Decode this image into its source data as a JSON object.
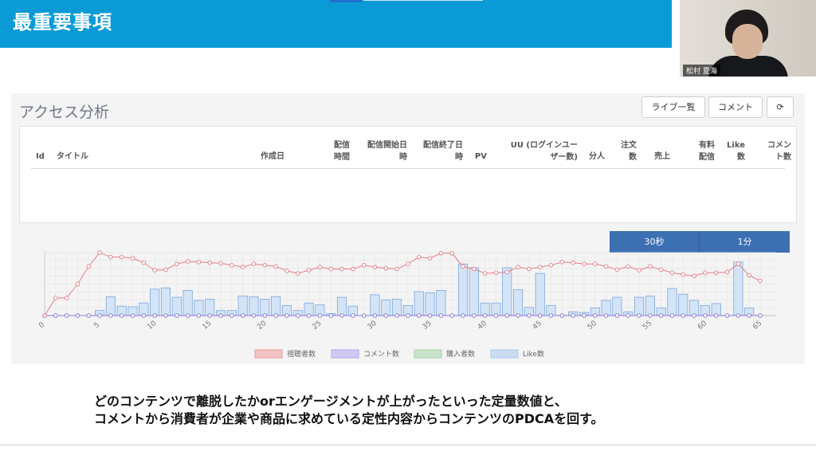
{
  "banner": {
    "title": "最重要事項"
  },
  "video": {
    "name": "松村 夏海"
  },
  "panel": {
    "title": "アクセス分析"
  },
  "toolbar": {
    "live_label": "ライブ一覧",
    "comment_label": "コメント",
    "refresh_glyph": "⟳"
  },
  "table": {
    "headers": [
      "Id",
      "タイトル",
      "作成日",
      "配信\n時間",
      "配信開始日\n時",
      "配信終了日\n時",
      "PV",
      "UU (ログインユー\nザー数)",
      "分人",
      "注文\n数",
      "売上",
      "有料\n配信",
      "Like\n数",
      "コメン\nト数"
    ]
  },
  "range_buttons": {
    "thirty_sec": "30秒",
    "one_min": "1分"
  },
  "chart_data": {
    "type": "line",
    "x_ticks": [
      "0",
      "5",
      "10",
      "15",
      "20",
      "25",
      "30",
      "35",
      "40",
      "45",
      "50",
      "55",
      "60",
      "65"
    ],
    "xlim": [
      0,
      65
    ],
    "legend": [
      "視聴者数",
      "コメント数",
      "購入者数",
      "Like数"
    ],
    "legend_colors": [
      "#ef9a9a",
      "#b3a6f2",
      "#a5d6a7",
      "#a9c8ef"
    ],
    "series": [
      {
        "name": "視聴者数",
        "kind": "line",
        "values": [
          0,
          28,
          28,
          50,
          78,
          100,
          93,
          93,
          91,
          84,
          72,
          73,
          82,
          86,
          85,
          84,
          83,
          80,
          77,
          82,
          80,
          78,
          71,
          67,
          72,
          77,
          74,
          74,
          74,
          80,
          77,
          75,
          74,
          82,
          93,
          91,
          99,
          99,
          78,
          74,
          67,
          68,
          69,
          77,
          74,
          77,
          80,
          85,
          84,
          82,
          82,
          78,
          73,
          78,
          72,
          78,
          73,
          68,
          65,
          63,
          68,
          68,
          69,
          82,
          64,
          55
        ]
      },
      {
        "name": "コメント数",
        "kind": "line",
        "values": [
          0,
          0,
          0,
          0,
          0,
          0,
          0,
          0,
          0,
          0,
          0,
          0,
          0,
          0,
          0,
          0,
          0,
          0,
          0,
          0,
          0,
          0,
          0,
          0,
          0,
          0,
          0,
          0,
          0,
          0,
          0,
          0,
          0,
          0,
          0,
          0,
          0,
          0,
          0,
          0,
          0,
          0,
          0,
          0,
          0,
          0,
          0,
          0,
          0,
          0,
          0,
          0,
          0,
          0,
          0,
          0,
          0,
          0,
          0,
          0,
          0,
          0,
          0,
          0,
          0,
          0
        ]
      },
      {
        "name": "購入者数",
        "kind": "line",
        "values": [
          0,
          0,
          0,
          0,
          0,
          0,
          0,
          0,
          0,
          0,
          0,
          0,
          0,
          0,
          0,
          0,
          0,
          0,
          0,
          0,
          0,
          0,
          0,
          0,
          0,
          0,
          0,
          0,
          0,
          0,
          0,
          0,
          0,
          0,
          0,
          0,
          0,
          0,
          0,
          0,
          0,
          0,
          0,
          0,
          0,
          0,
          0,
          0,
          0,
          0,
          0,
          0,
          0,
          0,
          0,
          0,
          0,
          0,
          0,
          0,
          0,
          0,
          0,
          0,
          0,
          0
        ]
      },
      {
        "name": "Like数",
        "kind": "bar",
        "values": [
          0,
          0,
          0,
          0,
          0,
          8,
          30,
          15,
          14,
          20,
          42,
          44,
          29,
          40,
          24,
          26,
          8,
          8,
          31,
          30,
          26,
          30,
          16,
          8,
          20,
          17,
          3,
          29,
          15,
          0,
          33,
          25,
          26,
          16,
          38,
          36,
          40,
          0,
          82,
          76,
          20,
          20,
          76,
          41,
          13,
          67,
          16,
          0,
          6,
          5,
          12,
          24,
          29,
          6,
          29,
          31,
          12,
          43,
          34,
          24,
          16,
          19,
          0,
          85,
          12,
          0
        ]
      }
    ]
  },
  "caption": {
    "line1": "どのコンテンツで離脱したかorエンゲージメントが上がったといった定量数値と、",
    "line2": "コメントから消費者が企業や商品に求めている定性内容からコンテンツのPDCAを回す。"
  }
}
